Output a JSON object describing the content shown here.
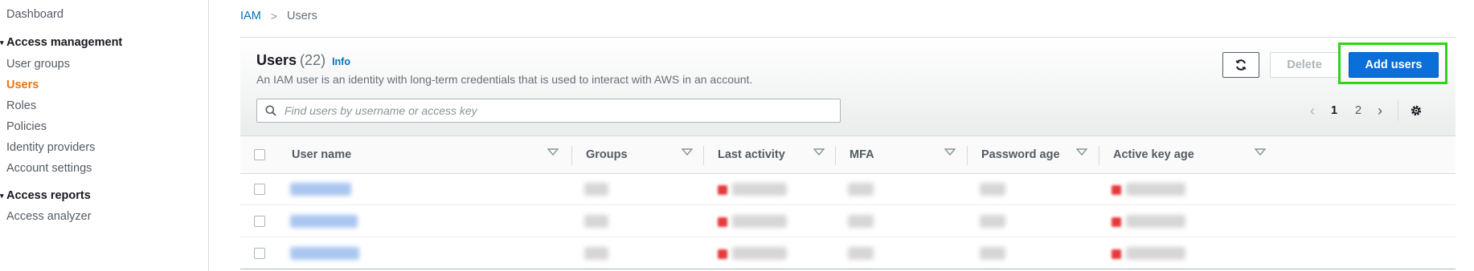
{
  "sidebar": {
    "items": [
      {
        "label": "Dashboard"
      },
      {
        "label": "Access management"
      },
      {
        "label": "User groups"
      },
      {
        "label": "Users"
      },
      {
        "label": "Roles"
      },
      {
        "label": "Policies"
      },
      {
        "label": "Identity providers"
      },
      {
        "label": "Account settings"
      },
      {
        "label": "Access reports"
      },
      {
        "label": "Access analyzer"
      }
    ],
    "active_item": "Users"
  },
  "breadcrumb": {
    "root": "IAM",
    "separator": ">",
    "current": "Users"
  },
  "panel": {
    "title": "Users",
    "count": "(22)",
    "info_link": "Info",
    "description": "An IAM user is an identity with long-term credentials that is used to interact with AWS in an account.",
    "buttons": {
      "refresh_icon": "refresh-icon",
      "delete_label": "Delete",
      "add_label": "Add users"
    },
    "search": {
      "placeholder": "Find users by username or access key",
      "value": ""
    },
    "pagination": {
      "current_page": "1",
      "next_page": "2"
    }
  },
  "table": {
    "columns": [
      "User name",
      "Groups",
      "Last activity",
      "MFA",
      "Password age",
      "Active key age"
    ],
    "rows_visible": 3
  },
  "colors": {
    "accent_orange": "#ec7211",
    "primary_blue": "#0a6fd8",
    "highlight_green": "#32d219"
  }
}
